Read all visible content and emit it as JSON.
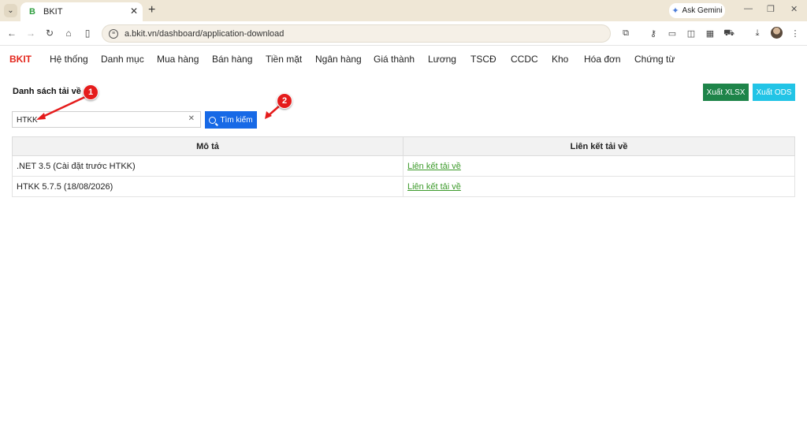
{
  "browser": {
    "tab_title": "BKIT",
    "favicon_letter": "B",
    "url": "a.bkit.vn/dashboard/application-download",
    "gemini_label": "Ask Gemini"
  },
  "app": {
    "brand": "BKIT",
    "menu": [
      "Hệ thống",
      "Danh mục",
      "Mua hàng",
      "Bán hàng",
      "Tiền mặt",
      "Ngân hàng",
      "Giá thành",
      "Lương",
      "TSCĐ",
      "CCDC",
      "Kho",
      "Hóa đơn",
      "Chứng từ"
    ]
  },
  "page": {
    "title": "Danh sách tải về",
    "export_xlsx": "Xuất XLSX",
    "export_ods": "Xuất ODS",
    "search_value": "HTKK",
    "search_button": "Tìm kiếm"
  },
  "table": {
    "headers": [
      "Mô tả",
      "Liên kết tải về"
    ],
    "rows": [
      {
        "desc": ".NET 3.5 (Cài đặt trước HTKK)",
        "link": "Liên kết tải về"
      },
      {
        "desc": "HTKK 5.7.5 (18/08/2026)",
        "link": "Liên kết tải về"
      }
    ]
  },
  "annotations": {
    "badge1": "1",
    "badge2": "2",
    "color": "#e51c1c"
  }
}
